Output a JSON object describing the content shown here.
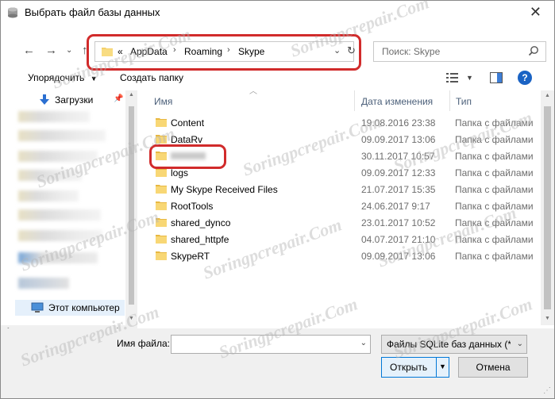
{
  "window": {
    "title": "Выбрать файл базы данных",
    "close_icon": "close-icon"
  },
  "address": {
    "prefix": "«",
    "crumbs": [
      "AppData",
      "Roaming",
      "Skype"
    ],
    "separator": "›",
    "highlight_color": "#d12b2b"
  },
  "search": {
    "placeholder": "Поиск: Skype"
  },
  "toolbar": {
    "organize": "Упорядочить",
    "new_folder": "Создать папку"
  },
  "navpane": {
    "downloads": "Загрузки",
    "this_pc": "Этот компьютер"
  },
  "columns": {
    "name": "Имя",
    "date": "Дата изменения",
    "type": "Тип"
  },
  "files": [
    {
      "name": "Content",
      "date": "19.08.2016 23:38",
      "type": "Папка с файлами"
    },
    {
      "name": "DataRv",
      "date": "09.09.2017 13:06",
      "type": "Папка с файлами"
    },
    {
      "name": "",
      "date": "30.11.2017 10:57",
      "type": "Папка с файлами"
    },
    {
      "name": "logs",
      "date": "09.09.2017 12:33",
      "type": "Папка с файлами"
    },
    {
      "name": "My Skype Received Files",
      "date": "21.07.2017 15:35",
      "type": "Папка с файлами"
    },
    {
      "name": "RootTools",
      "date": "24.06.2017 9:17",
      "type": "Папка с файлами"
    },
    {
      "name": "shared_dynco",
      "date": "23.01.2017 10:52",
      "type": "Папка с файлами"
    },
    {
      "name": "shared_httpfe",
      "date": "04.07.2017 21:10",
      "type": "Папка с файлами"
    },
    {
      "name": "SkypeRT",
      "date": "09.09.2017 13:06",
      "type": "Папка с файлами"
    }
  ],
  "footer": {
    "filename_label": "Имя файла:",
    "filename_value": "",
    "filter": "Файлы SQLite баз данных (*.db)",
    "open": "Открыть",
    "cancel": "Отмена"
  },
  "watermark": "Soringpcrepair.Com",
  "colors": {
    "accent": "#0078d7",
    "folder": "#f5d16b",
    "help": "#1a63c4"
  }
}
